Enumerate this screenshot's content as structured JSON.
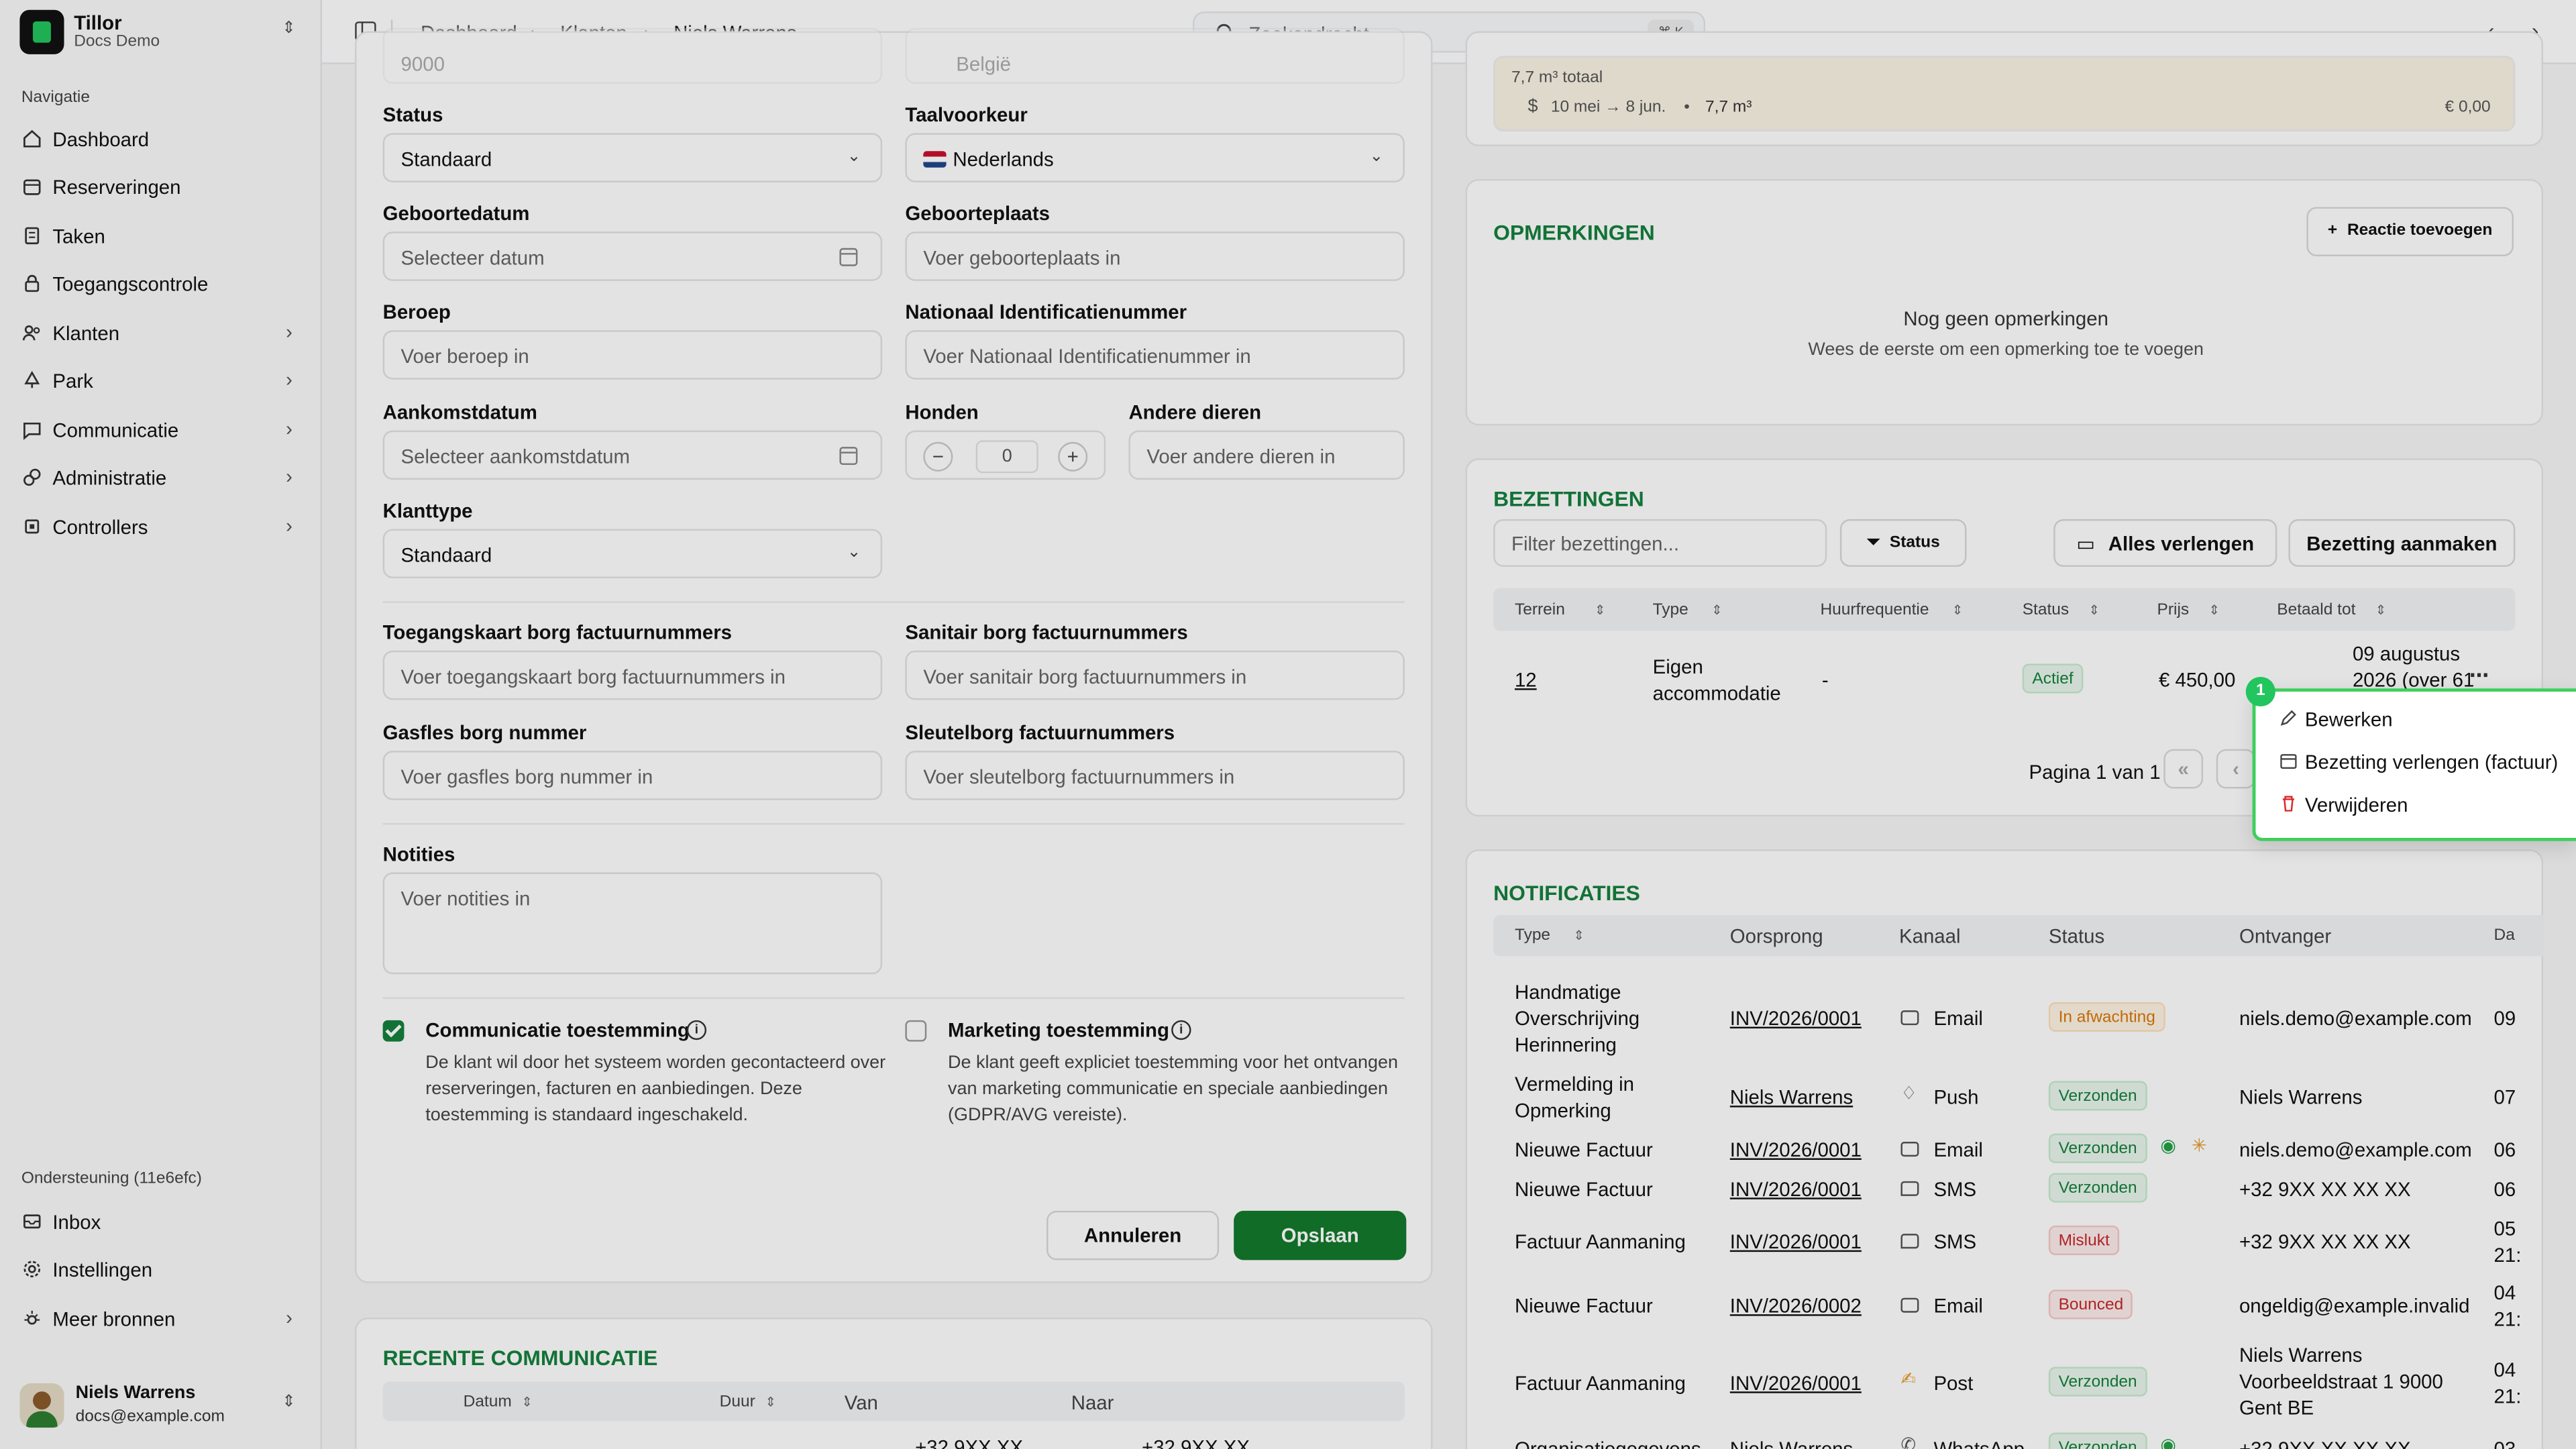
{
  "org": {
    "name": "Tillor",
    "sub": "Docs Demo"
  },
  "sidebar": {
    "nav_title": "Navigatie",
    "items": [
      {
        "label": "Dashboard",
        "icon": "home-icon"
      },
      {
        "label": "Reserveringen",
        "icon": "calendar-icon"
      },
      {
        "label": "Taken",
        "icon": "clipboard-icon"
      },
      {
        "label": "Toegangscontrole",
        "icon": "lock-icon"
      },
      {
        "label": "Klanten",
        "icon": "users-icon"
      },
      {
        "label": "Park",
        "icon": "park-icon"
      },
      {
        "label": "Communicatie",
        "icon": "chat-icon"
      },
      {
        "label": "Administratie",
        "icon": "link-icon"
      },
      {
        "label": "Controllers",
        "icon": "chip-icon"
      }
    ],
    "support_title": "Ondersteuning (11e6efc)",
    "support_items": [
      {
        "label": "Inbox",
        "icon": "mail-icon"
      },
      {
        "label": "Instellingen",
        "icon": "gear-icon"
      },
      {
        "label": "Meer bronnen",
        "icon": "sun-icon"
      }
    ],
    "user": {
      "name": "Niels Warrens",
      "email": "docs@example.com"
    }
  },
  "topbar": {
    "breadcrumb": [
      "Dashboard",
      "Klanten",
      "Niels Warrens"
    ],
    "search_placeholder": "Zoekopdracht",
    "search_kbd": "⌘ K"
  },
  "form": {
    "top_partial": {
      "postcode": "9000",
      "country": "België"
    },
    "status": {
      "label": "Status",
      "value": "Standaard"
    },
    "taal": {
      "label": "Taalvoorkeur",
      "value": "Nederlands"
    },
    "geboortedatum": {
      "label": "Geboortedatum",
      "placeholder": "Selecteer datum"
    },
    "geboorteplaats": {
      "label": "Geboorteplaats",
      "placeholder": "Voer geboorteplaats in"
    },
    "beroep": {
      "label": "Beroep",
      "placeholder": "Voer beroep in"
    },
    "nid": {
      "label": "Nationaal Identificatienummer",
      "placeholder": "Voer Nationaal Identificatienummer in"
    },
    "aankomst": {
      "label": "Aankomstdatum",
      "placeholder": "Selecteer aankomstdatum"
    },
    "honden": {
      "label": "Honden",
      "value": "0"
    },
    "dieren": {
      "label": "Andere dieren",
      "placeholder": "Voer andere dieren in"
    },
    "klanttype": {
      "label": "Klanttype",
      "value": "Standaard"
    },
    "toegang": {
      "label": "Toegangskaart borg factuurnummers",
      "placeholder": "Voer toegangskaart borg factuurnummers in"
    },
    "sanitair": {
      "label": "Sanitair borg factuurnummers",
      "placeholder": "Voer sanitair borg factuurnummers in"
    },
    "gasfles": {
      "label": "Gasfles borg nummer",
      "placeholder": "Voer gasfles borg nummer in"
    },
    "sleutel": {
      "label": "Sleutelborg factuurnummers",
      "placeholder": "Voer sleutelborg factuurnummers in"
    },
    "notities": {
      "label": "Notities",
      "placeholder": "Voer notities in"
    },
    "consent_comm": {
      "title": "Communicatie toestemming",
      "text": "De klant wil door het systeem worden gecontacteerd over reserveringen, facturen en aanbiedingen. Deze toestemming is standaard ingeschakeld.",
      "checked": true
    },
    "consent_mkt": {
      "title": "Marketing toestemming",
      "text": "De klant geeft expliciet toestemming voor het ontvangen van marketing communicatie en speciale aanbiedingen (GDPR/AVG vereiste).",
      "checked": false
    },
    "cancel": "Annuleren",
    "save": "Opslaan"
  },
  "recent": {
    "title": "RECENTE COMMUNICATIE",
    "headers": [
      "Datum",
      "Duur",
      "Van",
      "Naar"
    ],
    "row_partial": {
      "van": "+32 9XX XX",
      "naar": "+32 9XX XX"
    }
  },
  "usage": {
    "total": "7,7 m³ totaal",
    "period": "10 mei → 8 jun.",
    "amount": "7,7 m³",
    "price": "€ 0,00"
  },
  "opmerkingen": {
    "title": "OPMERKINGEN",
    "add": "Reactie toevoegen",
    "empty_title": "Nog geen opmerkingen",
    "empty_text": "Wees de eerste om een opmerking toe te voegen"
  },
  "bezettingen": {
    "title": "BEZETTINGEN",
    "filter_placeholder": "Filter bezettingen...",
    "status_btn": "Status",
    "extend_all": "Alles verlengen",
    "create": "Bezetting aanmaken",
    "headers": [
      "Terrein",
      "Type",
      "Huurfrequentie",
      "Status",
      "Prijs",
      "Betaald tot"
    ],
    "row": {
      "terrein": "12",
      "type": "Eigen accommodatie",
      "freq": "-",
      "status": "Actief",
      "prijs": "€ 450,00",
      "betaald": "09 augustus 2026 (over 61"
    },
    "pagination": "Pagina 1 van 1",
    "menu": [
      "Bewerken",
      "Bezetting verlengen (factuur)",
      "Verwijderen"
    ],
    "step": "1"
  },
  "notificaties": {
    "title": "NOTIFICATIES",
    "headers": [
      "Type",
      "Oorsprong",
      "Kanaal",
      "Status",
      "Ontvanger",
      "Da"
    ],
    "rows": [
      {
        "type": "Handmatige Overschrijving Herinnering",
        "origin": "INV/2026/0001",
        "channel": "Email",
        "status": "In afwachting",
        "recipient": "niels.demo@example.com",
        "date": "09"
      },
      {
        "type": "Vermelding in Opmerking",
        "origin": "Niels Warrens",
        "channel": "Push",
        "status": "Verzonden",
        "recipient": "Niels Warrens",
        "date": "07"
      },
      {
        "type": "Nieuwe Factuur",
        "origin": "INV/2026/0001",
        "channel": "Email",
        "status": "Verzonden",
        "recipient": "niels.demo@example.com",
        "date": "06"
      },
      {
        "type": "Nieuwe Factuur",
        "origin": "INV/2026/0001",
        "channel": "SMS",
        "status": "Verzonden",
        "recipient": "+32 9XX XX XX XX",
        "date": "06"
      },
      {
        "type": "Factuur Aanmaning",
        "origin": "INV/2026/0001",
        "channel": "SMS",
        "status": "Mislukt",
        "recipient": "+32 9XX XX XX XX",
        "date": "05 21:"
      },
      {
        "type": "Nieuwe Factuur",
        "origin": "INV/2026/0002",
        "channel": "Email",
        "status": "Bounced",
        "recipient": "ongeldig@example.invalid",
        "date": "04 21:"
      },
      {
        "type": "Factuur Aanmaning",
        "origin": "INV/2026/0001",
        "channel": "Post",
        "status": "Verzonden",
        "recipient": "Niels Warrens Voorbeeldstraat 1 9000 Gent BE",
        "date": "04 21:"
      },
      {
        "type": "Organisatiegegevens",
        "origin": "Niels Warrens",
        "channel": "WhatsApp",
        "status": "Verzonden",
        "recipient": "+32 9XX XX XX XX",
        "date": "03"
      }
    ]
  },
  "colors": {
    "accent": "#15803d",
    "highlight": "#3ecf5b"
  }
}
